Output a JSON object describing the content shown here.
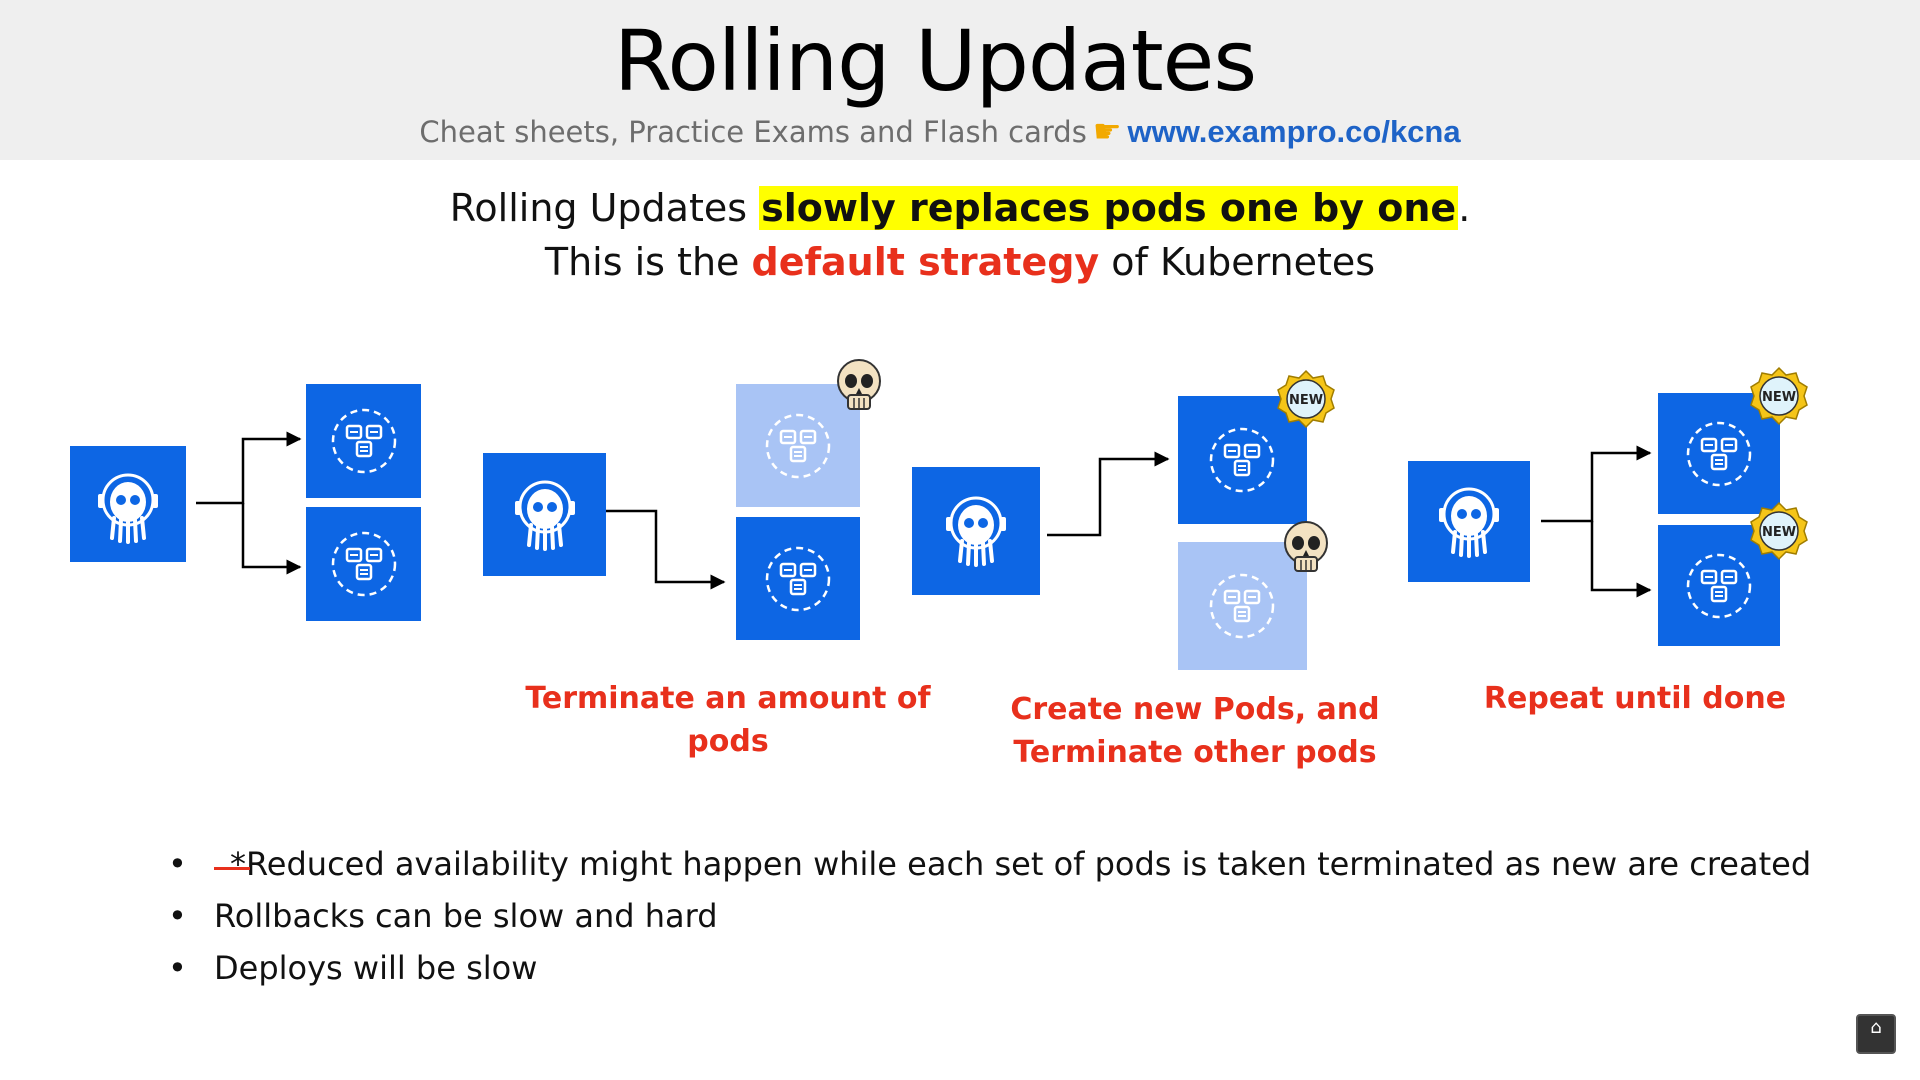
{
  "header": {
    "title": "Rolling Updates",
    "subtitle_text": "Cheat sheets, Practice Exams and Flash cards",
    "hand_icon": "pointing-hand-icon",
    "link": "www.exampro.co/kcna"
  },
  "intro": {
    "line1_prefix": "Rolling Updates ",
    "line1_highlight": "slowly replaces pods one by one",
    "line1_suffix": ".",
    "line2_prefix": "This is the ",
    "line2_emphasis": "default strategy",
    "line2_suffix": " of Kubernetes"
  },
  "diagram": {
    "badge_new": "NEW",
    "captions": {
      "step2": "Terminate an amount of pods",
      "step3_line1": "Create new Pods, and",
      "step3_line2": "Terminate other pods",
      "step4": "Repeat until done"
    }
  },
  "bullets": [
    "*Reduced availability might happen while each set of pods is taken terminated as new are created",
    "Rollbacks can be slow and hard",
    "Deploys will be slow"
  ],
  "colors": {
    "blue": "#0d66e4",
    "faded_blue": "#a9c4f5",
    "red": "#e8301c",
    "highlight": "#ffff00",
    "badge": "#f5c518"
  },
  "icons": [
    "argo-octopus-icon",
    "pod-icon",
    "skull-icon",
    "new-badge-icon",
    "subscribe-icon"
  ]
}
